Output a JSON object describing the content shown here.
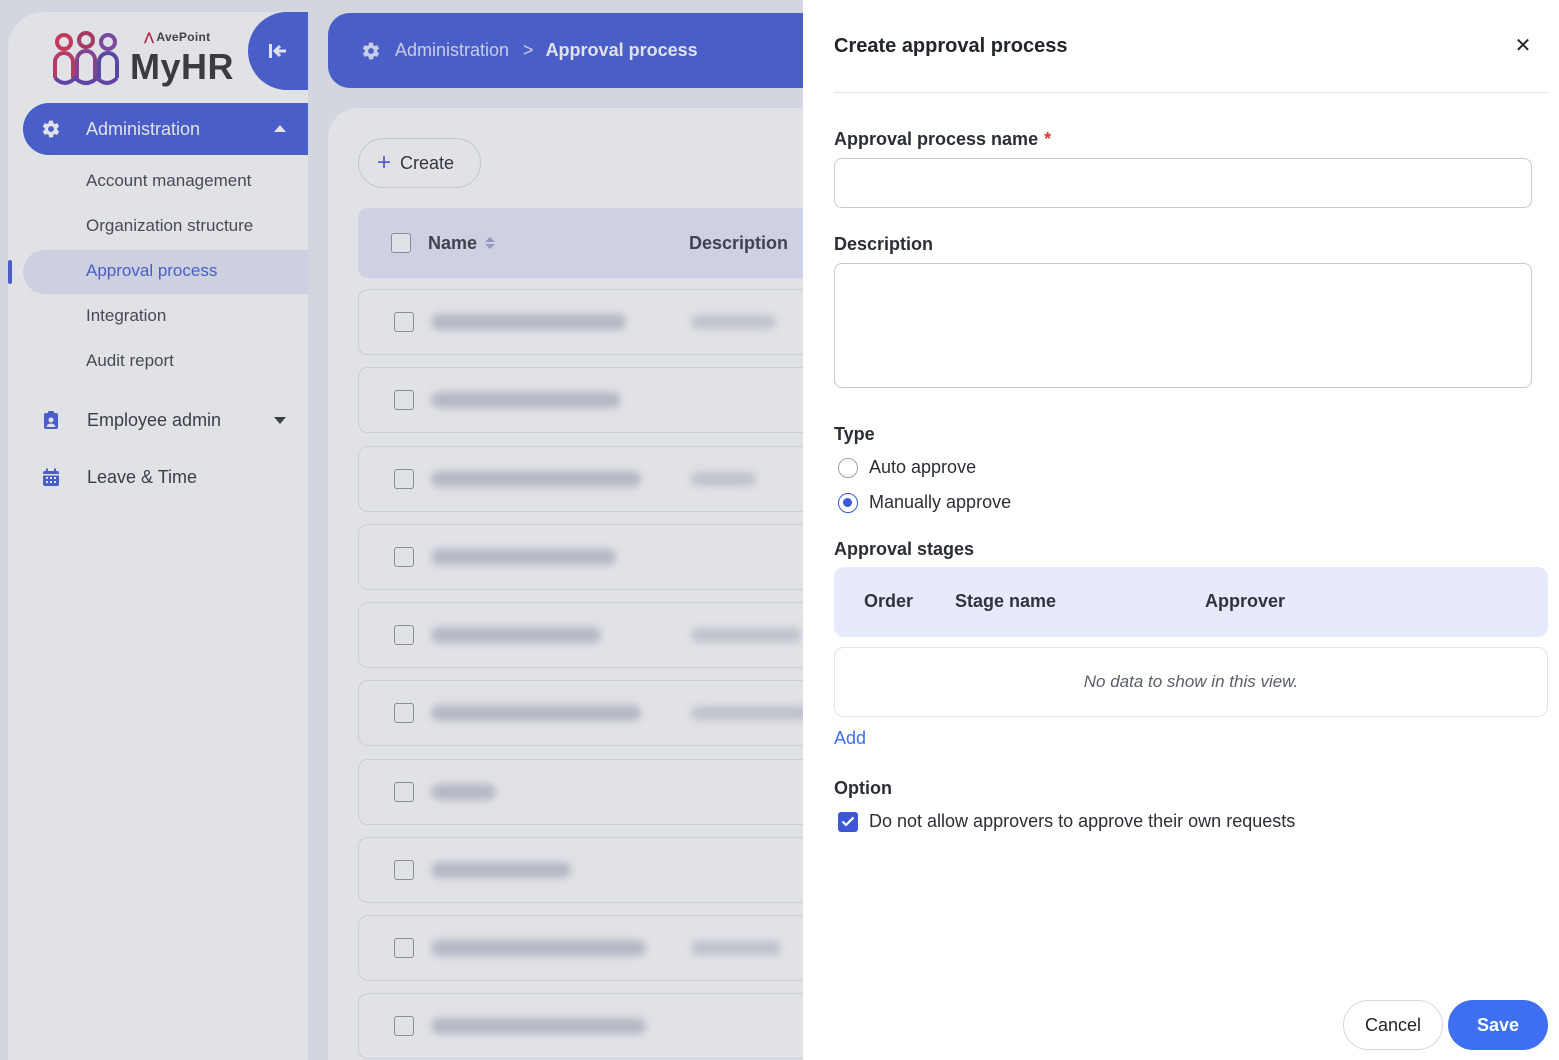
{
  "brand": {
    "company": "AvePoint",
    "product": "MyHR"
  },
  "sidebar": {
    "section_label": "Administration",
    "sub_items": [
      {
        "label": "Account management"
      },
      {
        "label": "Organization structure"
      },
      {
        "label": "Approval process",
        "active": true
      },
      {
        "label": "Integration"
      },
      {
        "label": "Audit report"
      }
    ],
    "nav_items": [
      {
        "label": "Employee admin",
        "icon": "badge-icon"
      },
      {
        "label": "Leave & Time",
        "icon": "calendar-icon"
      }
    ]
  },
  "header": {
    "breadcrumb": [
      "Administration",
      "Approval process"
    ],
    "separator": ">"
  },
  "list": {
    "create_label": "Create",
    "columns": [
      "Name",
      "Description"
    ],
    "row_count": 10
  },
  "drawer": {
    "title": "Create approval process",
    "fields": {
      "name_label": "Approval process name",
      "name_required": "*",
      "name_value": "",
      "description_label": "Description",
      "description_value": ""
    },
    "type": {
      "label": "Type",
      "options": [
        {
          "label": "Auto approve",
          "checked": false
        },
        {
          "label": "Manually approve",
          "checked": true
        }
      ]
    },
    "stages": {
      "label": "Approval stages",
      "columns": [
        "Order",
        "Stage name",
        "Approver"
      ],
      "empty_text": "No data to show in this view.",
      "add_label": "Add"
    },
    "option": {
      "label": "Option",
      "checkbox_label": "Do not allow approvers to approve their own requests",
      "checked": true
    },
    "buttons": {
      "cancel": "Cancel",
      "save": "Save"
    }
  },
  "colors": {
    "primary": "#3d57d6",
    "save_button": "#3d6ff0",
    "table_header_bg": "#e6eafb",
    "required": "#d43a3a"
  }
}
